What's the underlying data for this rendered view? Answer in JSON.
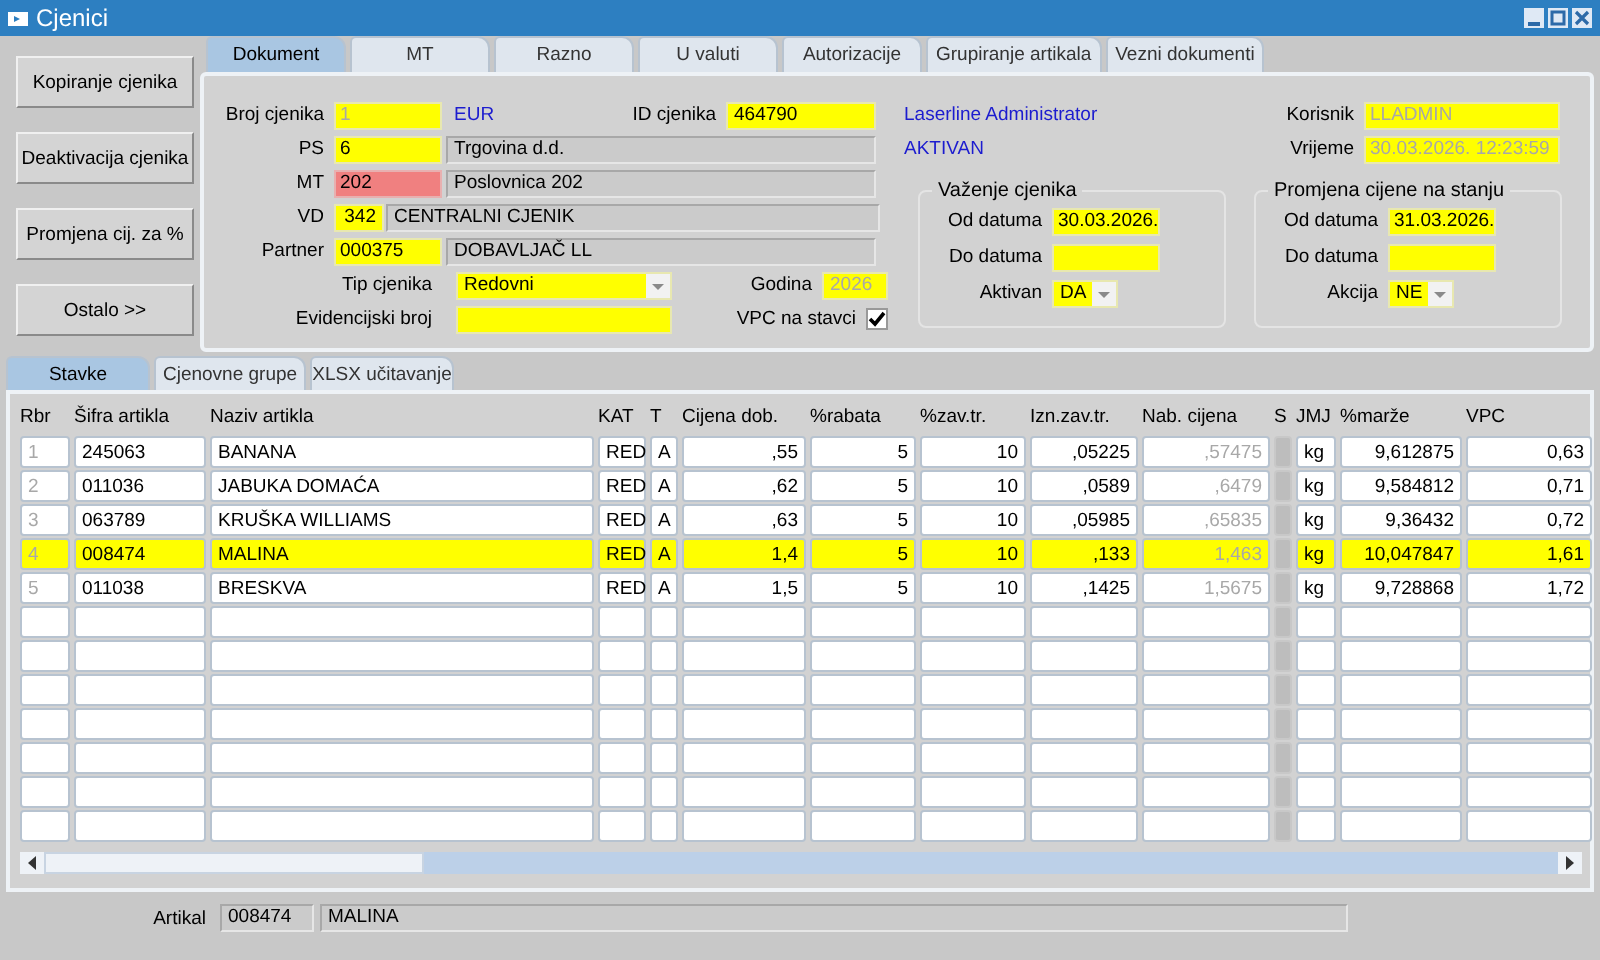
{
  "window": {
    "title": "Cjenici"
  },
  "actions": [
    "Kopiranje cjenika",
    "Deaktivacija cjenika",
    "Promjena cij. za %",
    "Ostalo >>"
  ],
  "tabs": [
    {
      "label": "Dokument",
      "selected": true
    },
    {
      "label": "MT",
      "selected": false
    },
    {
      "label": "Razno",
      "selected": false
    },
    {
      "label": "U valuti",
      "selected": false
    },
    {
      "label": "Autorizacije",
      "selected": false
    },
    {
      "label": "Grupiranje artikala",
      "selected": false
    },
    {
      "label": "Vezni dokumenti",
      "selected": false
    }
  ],
  "document": {
    "broj_cjenika": {
      "label": "Broj cjenika",
      "value": "1",
      "disabled": true
    },
    "valuta": "EUR",
    "id_cjenika": {
      "label": "ID cjenika",
      "value": "464790",
      "disabled": false
    },
    "codes": [
      {
        "label": "PS",
        "value": "6",
        "description": "Trgovina d.d.",
        "invalid": false,
        "kind": "wide"
      },
      {
        "label": "MT",
        "value": "202",
        "description": "Poslovnica 202",
        "invalid": true,
        "kind": "wide"
      },
      {
        "label": "VD",
        "value": "342",
        "description": "CENTRALNI CJENIK",
        "invalid": false,
        "kind": "narrow"
      },
      {
        "label": "Partner",
        "value": "000375",
        "description": "DOBAVLJAČ LL",
        "invalid": false,
        "kind": "wide"
      }
    ],
    "tip_cjenika": {
      "label": "Tip cjenika",
      "value": "Redovni"
    },
    "godina": {
      "label": "Godina",
      "value": "2026",
      "disabled": true
    },
    "evidencijski_broj": {
      "label": "Evidencijski broj"
    },
    "vpc_na_stavci": {
      "label": "VPC na stavci",
      "checked": true
    },
    "user_name": "Laserline Administrator",
    "status": "AKTIVAN",
    "korisnik": {
      "label": "Korisnik",
      "value": "LLADMIN",
      "disabled": true
    },
    "vrijeme": {
      "label": "Vrijeme",
      "value": "30.03.2026. 12:23:59",
      "disabled": true
    },
    "groups": [
      {
        "title": "Važenje cjenika",
        "fields": [
          {
            "label": "Od datuma",
            "value": "30.03.2026.",
            "kind": "text"
          },
          {
            "label": "Do datuma",
            "kind": "text"
          },
          {
            "label": "Aktivan",
            "value": "DA",
            "kind": "combo"
          }
        ]
      },
      {
        "title": "Promjena cijene na stanju",
        "fields": [
          {
            "label": "Od datuma",
            "value": "31.03.2026.",
            "kind": "text"
          },
          {
            "label": "Do datuma",
            "kind": "text"
          },
          {
            "label": "Akcija",
            "value": "NE",
            "kind": "combo"
          }
        ]
      }
    ]
  },
  "subtabs": [
    {
      "label": "Stavke",
      "selected": true
    },
    {
      "label": "Cjenovne grupe",
      "selected": false
    },
    {
      "label": "XLSX učitavanje",
      "selected": false
    }
  ],
  "table": {
    "columns": [
      {
        "label": "Rbr",
        "kind": "readonly"
      },
      {
        "label": "Šifra artikla",
        "kind": "text"
      },
      {
        "label": "Naziv artikla",
        "kind": "text"
      },
      {
        "label": "KAT",
        "kind": "text"
      },
      {
        "label": "T",
        "kind": "text"
      },
      {
        "label": "Cijena dob.",
        "kind": "number"
      },
      {
        "label": "%rabata",
        "kind": "number"
      },
      {
        "label": "%zav.tr.",
        "kind": "number"
      },
      {
        "label": "Izn.zav.tr.",
        "kind": "number"
      },
      {
        "label": "Nab. cijena",
        "kind": "readonly_number"
      },
      {
        "label": "S",
        "kind": "marker"
      },
      {
        "label": "JMJ",
        "kind": "text"
      },
      {
        "label": "%marže",
        "kind": "number"
      },
      {
        "label": "VPC",
        "kind": "number"
      }
    ],
    "rows": [
      {
        "selected": false,
        "cells": [
          "1",
          "245063",
          "BANANA",
          "RED",
          "A",
          ",55",
          "5",
          "10",
          ",05225",
          ",57475",
          "",
          "kg",
          "9,612875",
          "0,63"
        ]
      },
      {
        "selected": false,
        "cells": [
          "2",
          "011036",
          "JABUKA DOMAĆA",
          "RED",
          "A",
          ",62",
          "5",
          "10",
          ",0589",
          ",6479",
          "",
          "kg",
          "9,584812",
          "0,71"
        ]
      },
      {
        "selected": false,
        "cells": [
          "3",
          "063789",
          "KRUŠKA WILLIAMS",
          "RED",
          "A",
          ",63",
          "5",
          "10",
          ",05985",
          ",65835",
          "",
          "kg",
          "9,36432",
          "0,72"
        ]
      },
      {
        "selected": true,
        "cells": [
          "4",
          "008474",
          "MALINA",
          "RED",
          "A",
          "1,4",
          "5",
          "10",
          ",133",
          "1,463",
          "",
          "kg",
          "10,047847",
          "1,61"
        ]
      },
      {
        "selected": false,
        "cells": [
          "5",
          "011038",
          "BRESKVA",
          "RED",
          "A",
          "1,5",
          "5",
          "10",
          ",1425",
          "1,5675",
          "",
          "kg",
          "9,728868",
          "1,72"
        ]
      }
    ]
  },
  "footer": {
    "label": "Artikal",
    "code": "008474",
    "name": "MALINA"
  }
}
